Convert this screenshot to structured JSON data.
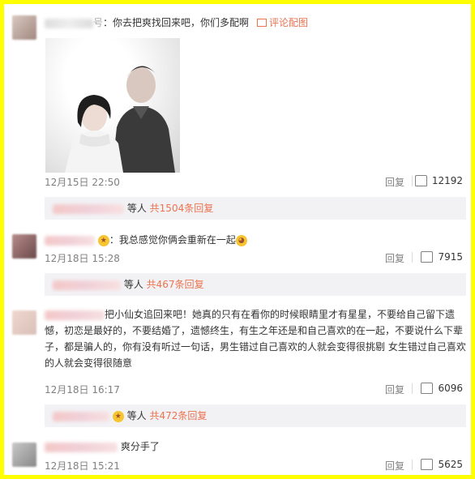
{
  "colors": {
    "accent": "#eb7350",
    "background_frame": "#ffff00",
    "sub_bg": "#f2f2f5"
  },
  "comments": [
    {
      "text": "：你去把爽找回来吧，你们多配啊",
      "pic_link": "评论配图",
      "time": "12月15日 22:50",
      "reply": "回复",
      "likes": "12192",
      "sub_suffix": "等人",
      "sub_count": "共1504条回复"
    },
    {
      "text": "：我总感觉你俩会重新在一起",
      "time": "12月18日 15:28",
      "reply": "回复",
      "likes": "7915",
      "sub_suffix": "等人",
      "sub_count": "共467条回复"
    },
    {
      "text_line1": "把小仙女追回来吧！她真的只有在看你的时候眼睛里才有星星，不要给自己留下遗",
      "text_rest": "憾，初恋是最好的，不要结婚了，遗憾终生，有生之年还是和自己喜欢的在一起，不要说什么下辈子，都是骗人的，你有没有听过一句话，男生错过自己喜欢的人就会变得很挑剔 女生错过自己喜欢的人就会变得很随意",
      "time": "12月18日 16:17",
      "reply": "回复",
      "likes": "6096",
      "sub_suffix": "等人",
      "sub_count": "共472条回复"
    },
    {
      "text": "爽分手了",
      "time": "12月18日 15:21",
      "reply": "回复",
      "likes": "5625"
    }
  ]
}
